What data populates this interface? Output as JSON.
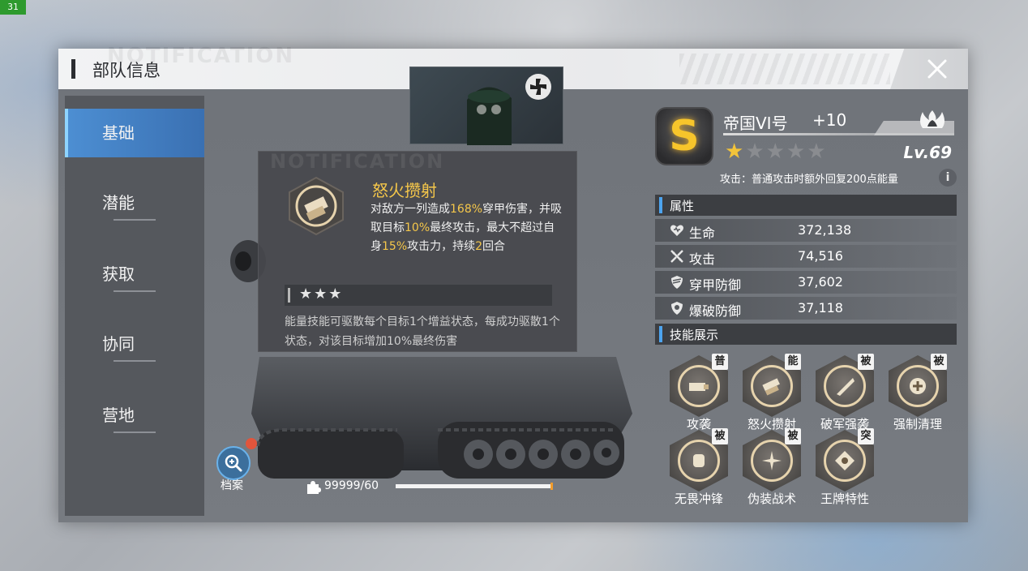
{
  "fps_counter": "31",
  "header": {
    "title": "部队信息",
    "ghost_text": "NOTIFICATION"
  },
  "sidebar": {
    "items": [
      {
        "label": "基础",
        "active": true
      },
      {
        "label": "潜能",
        "active": false
      },
      {
        "label": "获取",
        "active": false
      },
      {
        "label": "协同",
        "active": false
      },
      {
        "label": "营地",
        "active": false
      }
    ]
  },
  "tooltip": {
    "ghost_text": "NOTIFICATION",
    "skill_name": "怒火攒射",
    "desc_parts": [
      "对敌方一列造成",
      "168%",
      "穿甲伤害，并吸取目标",
      "10%",
      "最终攻击，最大不超过自身",
      "15%",
      "攻击力，持续",
      "2",
      "回合"
    ],
    "star_count": 3,
    "stars": "★★★",
    "upgrade_desc": "能量技能可驱散每个目标1个增益状态，每成功驱散1个状态，对该目标增加10%最终伤害"
  },
  "archive": {
    "label": "档案"
  },
  "progress": {
    "text": "99999/60",
    "fill_fraction": 0.99
  },
  "unit": {
    "rank": "S",
    "name": "帝国VI号",
    "plus": "+10",
    "stars_on": 1,
    "stars_total": 5,
    "level": "Lv.69",
    "passive": "攻击：普通攻击时额外回复200点能量",
    "info_icon": "i"
  },
  "attributes": {
    "title": "属性",
    "rows": [
      {
        "icon": "heart-icon",
        "label": "生命",
        "value": "372,138"
      },
      {
        "icon": "attack-icon",
        "label": "攻击",
        "value": "74,516"
      },
      {
        "icon": "armor-shield-icon",
        "label": "穿甲防御",
        "value": "37,602"
      },
      {
        "icon": "blast-shield-icon",
        "label": "爆破防御",
        "value": "37,118"
      }
    ]
  },
  "skills": {
    "title": "技能展示",
    "items": [
      {
        "name": "攻袭",
        "tag": "普"
      },
      {
        "name": "怒火攒射",
        "tag": "能"
      },
      {
        "name": "破军强袭",
        "tag": "被"
      },
      {
        "name": "强制清理",
        "tag": "被"
      },
      {
        "name": "无畏冲锋",
        "tag": "被"
      },
      {
        "name": "伪装战术",
        "tag": "被"
      },
      {
        "name": "王牌特性",
        "tag": "突"
      }
    ]
  },
  "colors": {
    "accent_blue": "#4d8fd3",
    "highlight_gold": "#f5c74a",
    "rank_gold": "#f7c52b"
  }
}
